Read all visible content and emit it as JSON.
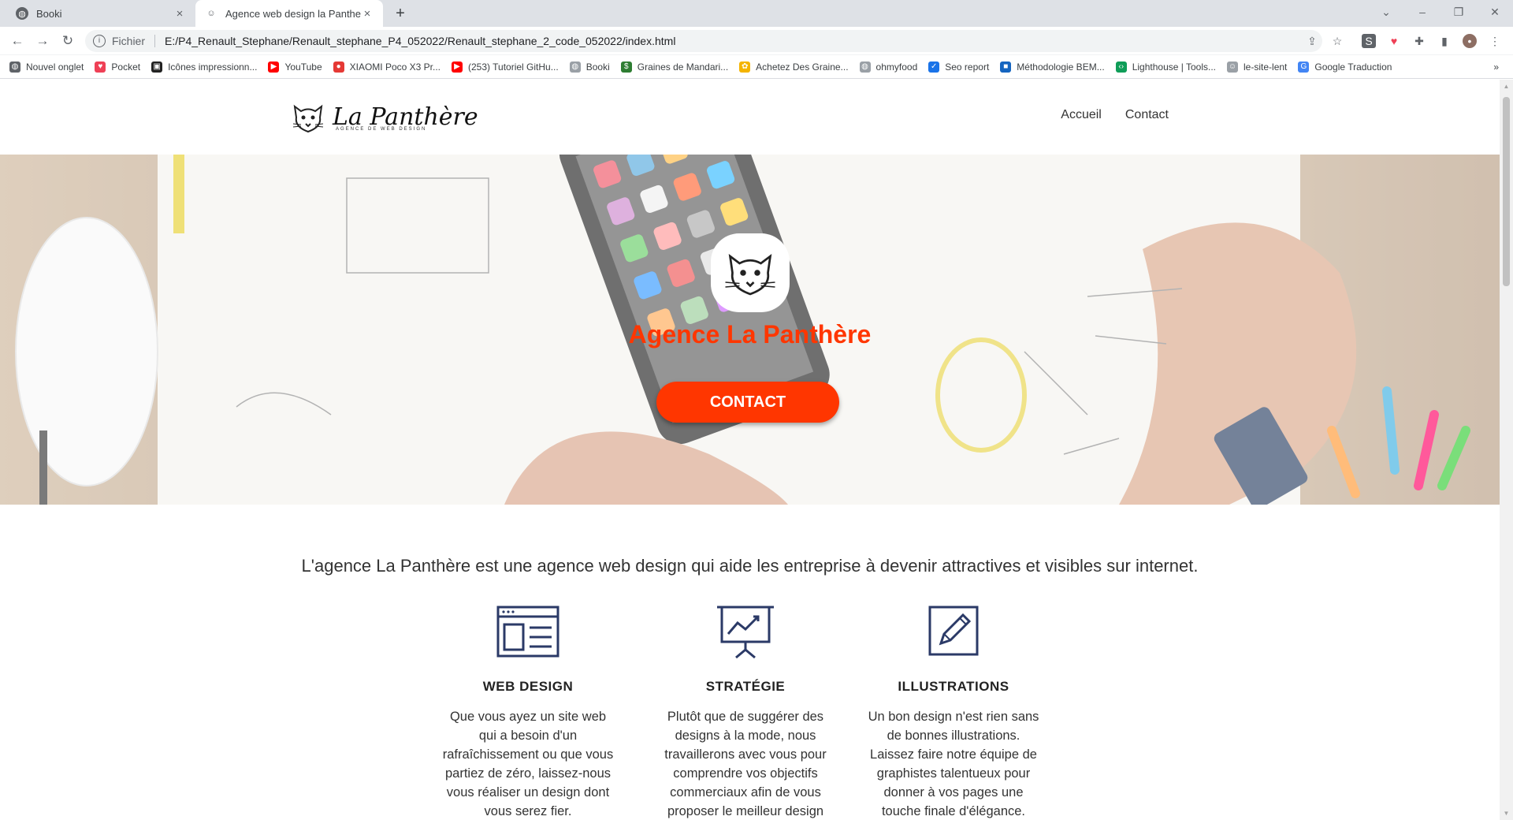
{
  "browser": {
    "tabs": [
      {
        "title": "Booki",
        "active": false
      },
      {
        "title": "Agence web design la Panthere",
        "active": true
      }
    ],
    "address": {
      "scheme": "Fichier",
      "url": "E:/P4_Renault_Stephane/Renault_stephane_P4_052022/Renault_stephane_2_code_052022/index.html"
    },
    "bookmarks": [
      {
        "label": "Nouvel onglet",
        "icon": "globe-icon",
        "color": "#5f6368"
      },
      {
        "label": "Pocket",
        "icon": "pocket-icon",
        "color": "#ef4056"
      },
      {
        "label": "Icônes impressionn...",
        "icon": "flag-icon",
        "color": "#222222"
      },
      {
        "label": "YouTube",
        "icon": "youtube-icon",
        "color": "#ff0000"
      },
      {
        "label": "XIAOMI Poco X3 Pr...",
        "icon": "circle-icon",
        "color": "#e53935"
      },
      {
        "label": "(253) Tutoriel GitHu...",
        "icon": "youtube-icon",
        "color": "#ff0000"
      },
      {
        "label": "Booki",
        "icon": "globe-icon",
        "color": "#9aa0a6"
      },
      {
        "label": "Graines de Mandari...",
        "icon": "dollar-icon",
        "color": "#2e7d32"
      },
      {
        "label": "Achetez Des Graine...",
        "icon": "leaf-icon",
        "color": "#f4b400"
      },
      {
        "label": "ohmyfood",
        "icon": "globe-icon",
        "color": "#9aa0a6"
      },
      {
        "label": "Seo report",
        "icon": "check-icon",
        "color": "#1a73e8"
      },
      {
        "label": "Méthodologie BEM...",
        "icon": "square-icon",
        "color": "#1565c0"
      },
      {
        "label": "Lighthouse | Tools...",
        "icon": "code-icon",
        "color": "#0f9d58"
      },
      {
        "label": "le-site-lent",
        "icon": "mascot-icon",
        "color": "#9aa0a6"
      },
      {
        "label": "Google Traduction",
        "icon": "translate-icon",
        "color": "#4285f4"
      }
    ]
  },
  "site": {
    "brand": "La Panthère",
    "tagline": "AGENCE DE WEB DESIGN",
    "nav": [
      "Accueil",
      "Contact"
    ],
    "hero": {
      "title": "Agence La Panthère",
      "cta": "CONTACT"
    },
    "intro": "L'agence La Panthère est une agence web design qui aide les entreprise à devenir attractives et visibles sur internet.",
    "services": [
      {
        "icon": "web-design-icon",
        "title": "WEB DESIGN",
        "text": "Que vous ayez un site web qui a besoin d'un rafraîchissement ou que vous partiez de zéro, laissez-nous vous réaliser un design dont vous serez fier."
      },
      {
        "icon": "strategy-chart-icon",
        "title": "STRATÉGIE",
        "text": "Plutôt que de suggérer des designs à la mode, nous travaillerons avec vous pour comprendre vos objectifs commerciaux afin de vous proposer le meilleur design"
      },
      {
        "icon": "pencil-illustration-icon",
        "title": "ILLUSTRATIONS",
        "text": "Un bon design n'est rien sans de bonnes illustrations. Laissez faire notre équipe de graphistes talentueux pour donner à vos pages une touche finale d'élégance."
      }
    ]
  },
  "colors": {
    "accent": "#ff3600",
    "icon_stroke": "#2b3a67"
  }
}
